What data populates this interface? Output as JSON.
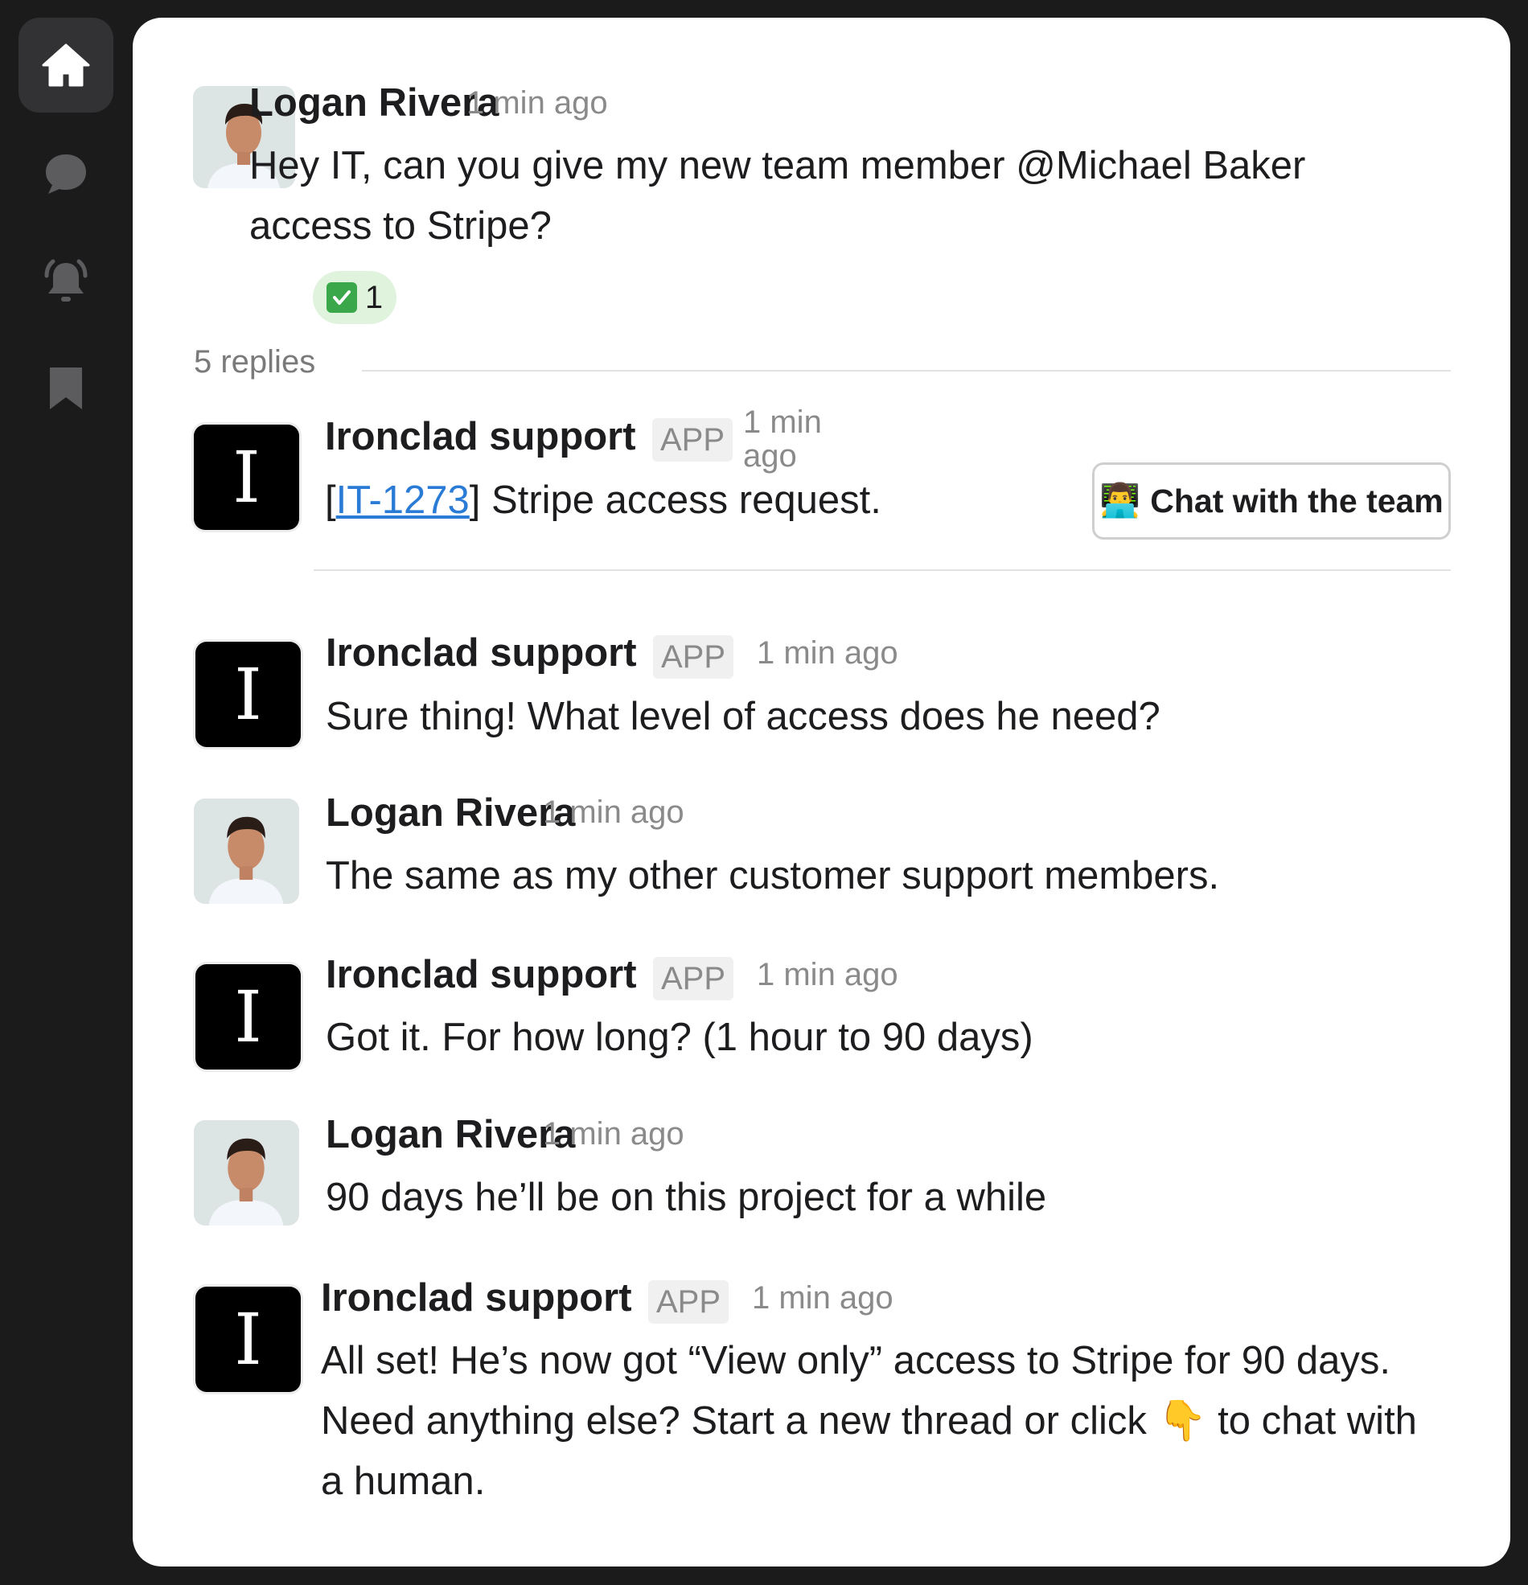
{
  "sidebar": {
    "items": [
      {
        "name": "home",
        "icon": "home-icon",
        "active": true
      },
      {
        "name": "messages",
        "icon": "chat-bubble-icon"
      },
      {
        "name": "notifications",
        "icon": "bell-icon"
      },
      {
        "name": "saved",
        "icon": "bookmark-icon"
      }
    ]
  },
  "thread": {
    "parent": {
      "author": "Logan Rivera",
      "time": "1 min ago",
      "text": "Hey IT, can you give my new team member @Michael Baker access to Stripe?",
      "reaction": {
        "emoji": "✅",
        "count": "1"
      }
    },
    "replies_label": "5 replies",
    "first_reply": {
      "author": "Ironclad support",
      "badge": "APP",
      "time": "1 min ago",
      "bracket_open": "[",
      "ticket": "IT-1273",
      "bracket_close": "]",
      "text": " Stripe access request.",
      "button_emoji": "👨‍💻",
      "button_label": "Chat with the team"
    },
    "messages": [
      {
        "author": "Ironclad support",
        "badge": "APP",
        "time": "1 min ago",
        "text": "Sure thing! What level of access does he need?"
      },
      {
        "author": "Logan Rivera",
        "time": "1 min ago",
        "text": "The same as my other customer support members."
      },
      {
        "author": "Ironclad support",
        "badge": "APP",
        "time": "1 min ago",
        "text": "Got it. For how long? (1 hour to 90 days)"
      },
      {
        "author": "Logan Rivera",
        "time": "1 min ago",
        "text": "90 days he’ll be on this project for a while"
      },
      {
        "author": "Ironclad support",
        "badge": "APP",
        "time": "1 min ago",
        "text": "All set! He’s now got “View only” access to Stripe for 90 days. Need anything else? Start a new thread or click 👇 to chat with a human."
      }
    ],
    "avatar_letter": "I"
  },
  "colors": {
    "sidebar_bg": "#1b1b1c",
    "active_bg": "#323234",
    "link": "#2a7bd6",
    "reaction_bg": "#dff3dd"
  }
}
